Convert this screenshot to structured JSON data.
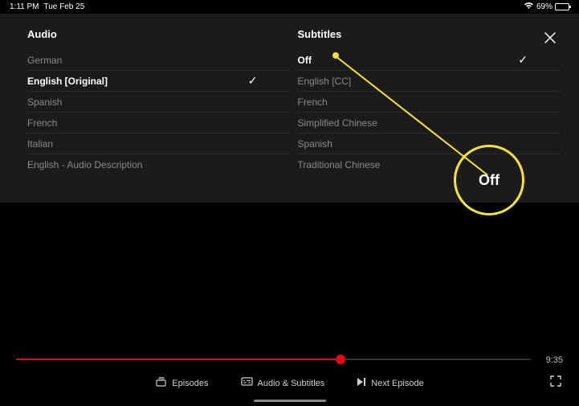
{
  "status": {
    "time": "1:11 PM",
    "date": "Tue Feb 25",
    "battery_percent": "69%"
  },
  "panel": {
    "audio_title": "Audio",
    "subtitles_title": "Subtitles",
    "audio_options": [
      {
        "label": "German",
        "selected": false
      },
      {
        "label": "English [Original]",
        "selected": true
      },
      {
        "label": "Spanish",
        "selected": false
      },
      {
        "label": "French",
        "selected": false
      },
      {
        "label": "Italian",
        "selected": false
      },
      {
        "label": "English - Audio Description",
        "selected": false
      }
    ],
    "subtitle_options": [
      {
        "label": "Off",
        "selected": true
      },
      {
        "label": "English [CC]",
        "selected": false
      },
      {
        "label": "French",
        "selected": false
      },
      {
        "label": "Simplified Chinese",
        "selected": false
      },
      {
        "label": "Spanish",
        "selected": false
      },
      {
        "label": "Traditional Chinese",
        "selected": false
      }
    ]
  },
  "playback": {
    "time_remaining": "9:35",
    "progress_percent": 63
  },
  "controls": {
    "episodes": "Episodes",
    "audio_subtitles": "Audio & Subtitles",
    "next_episode": "Next Episode"
  },
  "annotation": {
    "callout_text": "Off"
  }
}
